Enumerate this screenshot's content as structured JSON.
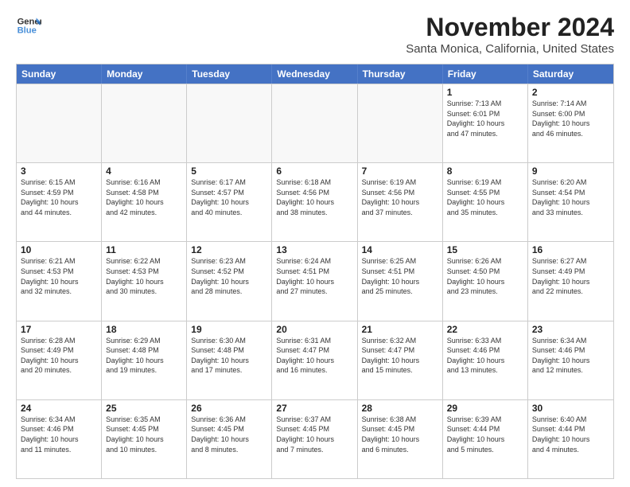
{
  "header": {
    "logo_line1": "General",
    "logo_line2": "Blue",
    "title": "November 2024",
    "subtitle": "Santa Monica, California, United States"
  },
  "weekdays": [
    "Sunday",
    "Monday",
    "Tuesday",
    "Wednesday",
    "Thursday",
    "Friday",
    "Saturday"
  ],
  "rows": [
    [
      {
        "day": "",
        "info": "",
        "empty": true
      },
      {
        "day": "",
        "info": "",
        "empty": true
      },
      {
        "day": "",
        "info": "",
        "empty": true
      },
      {
        "day": "",
        "info": "",
        "empty": true
      },
      {
        "day": "",
        "info": "",
        "empty": true
      },
      {
        "day": "1",
        "info": "Sunrise: 7:13 AM\nSunset: 6:01 PM\nDaylight: 10 hours\nand 47 minutes.",
        "empty": false
      },
      {
        "day": "2",
        "info": "Sunrise: 7:14 AM\nSunset: 6:00 PM\nDaylight: 10 hours\nand 46 minutes.",
        "empty": false
      }
    ],
    [
      {
        "day": "3",
        "info": "Sunrise: 6:15 AM\nSunset: 4:59 PM\nDaylight: 10 hours\nand 44 minutes.",
        "empty": false
      },
      {
        "day": "4",
        "info": "Sunrise: 6:16 AM\nSunset: 4:58 PM\nDaylight: 10 hours\nand 42 minutes.",
        "empty": false
      },
      {
        "day": "5",
        "info": "Sunrise: 6:17 AM\nSunset: 4:57 PM\nDaylight: 10 hours\nand 40 minutes.",
        "empty": false
      },
      {
        "day": "6",
        "info": "Sunrise: 6:18 AM\nSunset: 4:56 PM\nDaylight: 10 hours\nand 38 minutes.",
        "empty": false
      },
      {
        "day": "7",
        "info": "Sunrise: 6:19 AM\nSunset: 4:56 PM\nDaylight: 10 hours\nand 37 minutes.",
        "empty": false
      },
      {
        "day": "8",
        "info": "Sunrise: 6:19 AM\nSunset: 4:55 PM\nDaylight: 10 hours\nand 35 minutes.",
        "empty": false
      },
      {
        "day": "9",
        "info": "Sunrise: 6:20 AM\nSunset: 4:54 PM\nDaylight: 10 hours\nand 33 minutes.",
        "empty": false
      }
    ],
    [
      {
        "day": "10",
        "info": "Sunrise: 6:21 AM\nSunset: 4:53 PM\nDaylight: 10 hours\nand 32 minutes.",
        "empty": false
      },
      {
        "day": "11",
        "info": "Sunrise: 6:22 AM\nSunset: 4:53 PM\nDaylight: 10 hours\nand 30 minutes.",
        "empty": false
      },
      {
        "day": "12",
        "info": "Sunrise: 6:23 AM\nSunset: 4:52 PM\nDaylight: 10 hours\nand 28 minutes.",
        "empty": false
      },
      {
        "day": "13",
        "info": "Sunrise: 6:24 AM\nSunset: 4:51 PM\nDaylight: 10 hours\nand 27 minutes.",
        "empty": false
      },
      {
        "day": "14",
        "info": "Sunrise: 6:25 AM\nSunset: 4:51 PM\nDaylight: 10 hours\nand 25 minutes.",
        "empty": false
      },
      {
        "day": "15",
        "info": "Sunrise: 6:26 AM\nSunset: 4:50 PM\nDaylight: 10 hours\nand 23 minutes.",
        "empty": false
      },
      {
        "day": "16",
        "info": "Sunrise: 6:27 AM\nSunset: 4:49 PM\nDaylight: 10 hours\nand 22 minutes.",
        "empty": false
      }
    ],
    [
      {
        "day": "17",
        "info": "Sunrise: 6:28 AM\nSunset: 4:49 PM\nDaylight: 10 hours\nand 20 minutes.",
        "empty": false
      },
      {
        "day": "18",
        "info": "Sunrise: 6:29 AM\nSunset: 4:48 PM\nDaylight: 10 hours\nand 19 minutes.",
        "empty": false
      },
      {
        "day": "19",
        "info": "Sunrise: 6:30 AM\nSunset: 4:48 PM\nDaylight: 10 hours\nand 17 minutes.",
        "empty": false
      },
      {
        "day": "20",
        "info": "Sunrise: 6:31 AM\nSunset: 4:47 PM\nDaylight: 10 hours\nand 16 minutes.",
        "empty": false
      },
      {
        "day": "21",
        "info": "Sunrise: 6:32 AM\nSunset: 4:47 PM\nDaylight: 10 hours\nand 15 minutes.",
        "empty": false
      },
      {
        "day": "22",
        "info": "Sunrise: 6:33 AM\nSunset: 4:46 PM\nDaylight: 10 hours\nand 13 minutes.",
        "empty": false
      },
      {
        "day": "23",
        "info": "Sunrise: 6:34 AM\nSunset: 4:46 PM\nDaylight: 10 hours\nand 12 minutes.",
        "empty": false
      }
    ],
    [
      {
        "day": "24",
        "info": "Sunrise: 6:34 AM\nSunset: 4:46 PM\nDaylight: 10 hours\nand 11 minutes.",
        "empty": false
      },
      {
        "day": "25",
        "info": "Sunrise: 6:35 AM\nSunset: 4:45 PM\nDaylight: 10 hours\nand 10 minutes.",
        "empty": false
      },
      {
        "day": "26",
        "info": "Sunrise: 6:36 AM\nSunset: 4:45 PM\nDaylight: 10 hours\nand 8 minutes.",
        "empty": false
      },
      {
        "day": "27",
        "info": "Sunrise: 6:37 AM\nSunset: 4:45 PM\nDaylight: 10 hours\nand 7 minutes.",
        "empty": false
      },
      {
        "day": "28",
        "info": "Sunrise: 6:38 AM\nSunset: 4:45 PM\nDaylight: 10 hours\nand 6 minutes.",
        "empty": false
      },
      {
        "day": "29",
        "info": "Sunrise: 6:39 AM\nSunset: 4:44 PM\nDaylight: 10 hours\nand 5 minutes.",
        "empty": false
      },
      {
        "day": "30",
        "info": "Sunrise: 6:40 AM\nSunset: 4:44 PM\nDaylight: 10 hours\nand 4 minutes.",
        "empty": false
      }
    ]
  ]
}
